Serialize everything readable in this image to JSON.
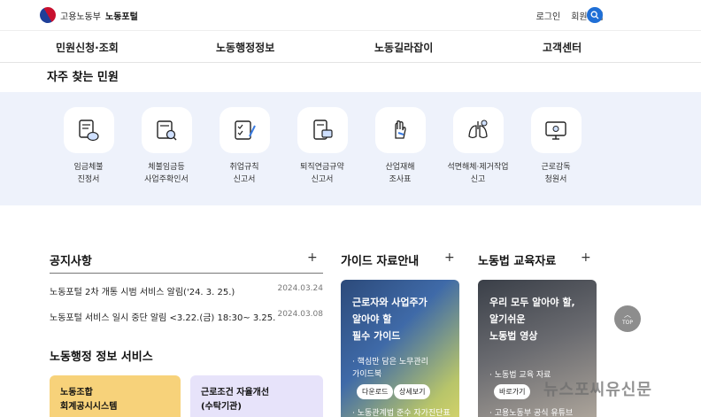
{
  "header": {
    "ministry": "고용노동부",
    "portal": "노동포털",
    "login": "로그인",
    "signup": "회원가입",
    "accent": "#1f6fd6"
  },
  "nav": [
    {
      "label": "민원신청·조회"
    },
    {
      "label": "노동행정정보"
    },
    {
      "label": "노동길라잡이"
    },
    {
      "label": "고객센터"
    }
  ],
  "frequent": {
    "title": "자주 찾는 민원",
    "items": [
      {
        "line1": "임금체불",
        "line2": "진정서",
        "icon": "wage-document-icon"
      },
      {
        "line1": "체불임금등",
        "line2": "사업주확인서",
        "icon": "certificate-search-icon"
      },
      {
        "line1": "취업규칙",
        "line2": "신고서",
        "icon": "checklist-icon"
      },
      {
        "line1": "퇴직연금규약",
        "line2": "신고서",
        "icon": "pension-document-icon"
      },
      {
        "line1": "산업재해",
        "line2": "조사표",
        "icon": "hand-injury-icon"
      },
      {
        "line1": "석면해체·제거작업",
        "line2": "신고",
        "icon": "lungs-icon"
      },
      {
        "line1": "근로감독",
        "line2": "청원서",
        "icon": "monitor-icon"
      }
    ]
  },
  "notice": {
    "title": "공지사항",
    "plus": "+",
    "items": [
      {
        "title": "노동포털 2차 개통 시범 서비스 알림('24. 3. 25.)",
        "date": "2024.03.24"
      },
      {
        "title": "노동포털 서비스 일시 중단 알림 <3.22.(금) 18:30~ 3.25.(…",
        "date": "2024.03.08"
      }
    ]
  },
  "services": {
    "title": "노동행정 정보 서비스",
    "cards": [
      {
        "line1": "노동조합",
        "line2": "회계공시시스템"
      },
      {
        "line1": "근로조건 자율개선",
        "line2": "(수탁기관)"
      }
    ]
  },
  "guide": {
    "title": "가이드 자료안내",
    "plus": "+",
    "line1": "근로자와 사업주가",
    "line2": "알아야 할",
    "line3": "필수 가이드",
    "sub1": "· 핵심만 담은 노무관리",
    "sub2": "가이드북",
    "download": "다운로드",
    "detail": "상세보기",
    "sub3": "· 노동관계법 준수 자가진단표"
  },
  "edu": {
    "title": "노동법 교육자료",
    "plus": "+",
    "line1": "우리 모두 알아야 할,",
    "line2": "알기쉬운",
    "line3": "노동법 영상",
    "sub1": "· 노동법 교육 자료",
    "go": "바로가기",
    "sub2": "· 고용노동부 공식 유튜브"
  },
  "top_button": "TOP",
  "watermark": "뉴스포씨유신문"
}
